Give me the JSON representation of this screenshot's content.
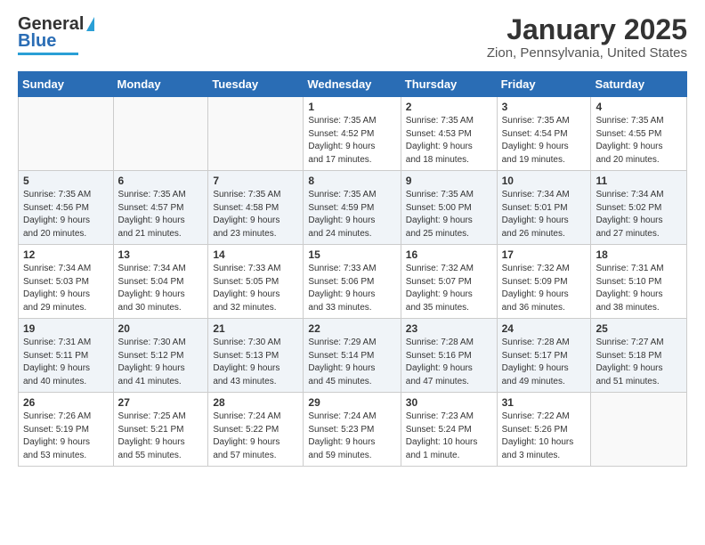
{
  "header": {
    "logo_line1": "General",
    "logo_line2": "Blue",
    "title": "January 2025",
    "subtitle": "Zion, Pennsylvania, United States"
  },
  "weekdays": [
    "Sunday",
    "Monday",
    "Tuesday",
    "Wednesday",
    "Thursday",
    "Friday",
    "Saturday"
  ],
  "weeks": [
    [
      {
        "day": "",
        "info": ""
      },
      {
        "day": "",
        "info": ""
      },
      {
        "day": "",
        "info": ""
      },
      {
        "day": "1",
        "info": "Sunrise: 7:35 AM\nSunset: 4:52 PM\nDaylight: 9 hours\nand 17 minutes."
      },
      {
        "day": "2",
        "info": "Sunrise: 7:35 AM\nSunset: 4:53 PM\nDaylight: 9 hours\nand 18 minutes."
      },
      {
        "day": "3",
        "info": "Sunrise: 7:35 AM\nSunset: 4:54 PM\nDaylight: 9 hours\nand 19 minutes."
      },
      {
        "day": "4",
        "info": "Sunrise: 7:35 AM\nSunset: 4:55 PM\nDaylight: 9 hours\nand 20 minutes."
      }
    ],
    [
      {
        "day": "5",
        "info": "Sunrise: 7:35 AM\nSunset: 4:56 PM\nDaylight: 9 hours\nand 20 minutes."
      },
      {
        "day": "6",
        "info": "Sunrise: 7:35 AM\nSunset: 4:57 PM\nDaylight: 9 hours\nand 21 minutes."
      },
      {
        "day": "7",
        "info": "Sunrise: 7:35 AM\nSunset: 4:58 PM\nDaylight: 9 hours\nand 23 minutes."
      },
      {
        "day": "8",
        "info": "Sunrise: 7:35 AM\nSunset: 4:59 PM\nDaylight: 9 hours\nand 24 minutes."
      },
      {
        "day": "9",
        "info": "Sunrise: 7:35 AM\nSunset: 5:00 PM\nDaylight: 9 hours\nand 25 minutes."
      },
      {
        "day": "10",
        "info": "Sunrise: 7:34 AM\nSunset: 5:01 PM\nDaylight: 9 hours\nand 26 minutes."
      },
      {
        "day": "11",
        "info": "Sunrise: 7:34 AM\nSunset: 5:02 PM\nDaylight: 9 hours\nand 27 minutes."
      }
    ],
    [
      {
        "day": "12",
        "info": "Sunrise: 7:34 AM\nSunset: 5:03 PM\nDaylight: 9 hours\nand 29 minutes."
      },
      {
        "day": "13",
        "info": "Sunrise: 7:34 AM\nSunset: 5:04 PM\nDaylight: 9 hours\nand 30 minutes."
      },
      {
        "day": "14",
        "info": "Sunrise: 7:33 AM\nSunset: 5:05 PM\nDaylight: 9 hours\nand 32 minutes."
      },
      {
        "day": "15",
        "info": "Sunrise: 7:33 AM\nSunset: 5:06 PM\nDaylight: 9 hours\nand 33 minutes."
      },
      {
        "day": "16",
        "info": "Sunrise: 7:32 AM\nSunset: 5:07 PM\nDaylight: 9 hours\nand 35 minutes."
      },
      {
        "day": "17",
        "info": "Sunrise: 7:32 AM\nSunset: 5:09 PM\nDaylight: 9 hours\nand 36 minutes."
      },
      {
        "day": "18",
        "info": "Sunrise: 7:31 AM\nSunset: 5:10 PM\nDaylight: 9 hours\nand 38 minutes."
      }
    ],
    [
      {
        "day": "19",
        "info": "Sunrise: 7:31 AM\nSunset: 5:11 PM\nDaylight: 9 hours\nand 40 minutes."
      },
      {
        "day": "20",
        "info": "Sunrise: 7:30 AM\nSunset: 5:12 PM\nDaylight: 9 hours\nand 41 minutes."
      },
      {
        "day": "21",
        "info": "Sunrise: 7:30 AM\nSunset: 5:13 PM\nDaylight: 9 hours\nand 43 minutes."
      },
      {
        "day": "22",
        "info": "Sunrise: 7:29 AM\nSunset: 5:14 PM\nDaylight: 9 hours\nand 45 minutes."
      },
      {
        "day": "23",
        "info": "Sunrise: 7:28 AM\nSunset: 5:16 PM\nDaylight: 9 hours\nand 47 minutes."
      },
      {
        "day": "24",
        "info": "Sunrise: 7:28 AM\nSunset: 5:17 PM\nDaylight: 9 hours\nand 49 minutes."
      },
      {
        "day": "25",
        "info": "Sunrise: 7:27 AM\nSunset: 5:18 PM\nDaylight: 9 hours\nand 51 minutes."
      }
    ],
    [
      {
        "day": "26",
        "info": "Sunrise: 7:26 AM\nSunset: 5:19 PM\nDaylight: 9 hours\nand 53 minutes."
      },
      {
        "day": "27",
        "info": "Sunrise: 7:25 AM\nSunset: 5:21 PM\nDaylight: 9 hours\nand 55 minutes."
      },
      {
        "day": "28",
        "info": "Sunrise: 7:24 AM\nSunset: 5:22 PM\nDaylight: 9 hours\nand 57 minutes."
      },
      {
        "day": "29",
        "info": "Sunrise: 7:24 AM\nSunset: 5:23 PM\nDaylight: 9 hours\nand 59 minutes."
      },
      {
        "day": "30",
        "info": "Sunrise: 7:23 AM\nSunset: 5:24 PM\nDaylight: 10 hours\nand 1 minute."
      },
      {
        "day": "31",
        "info": "Sunrise: 7:22 AM\nSunset: 5:26 PM\nDaylight: 10 hours\nand 3 minutes."
      },
      {
        "day": "",
        "info": ""
      }
    ]
  ]
}
